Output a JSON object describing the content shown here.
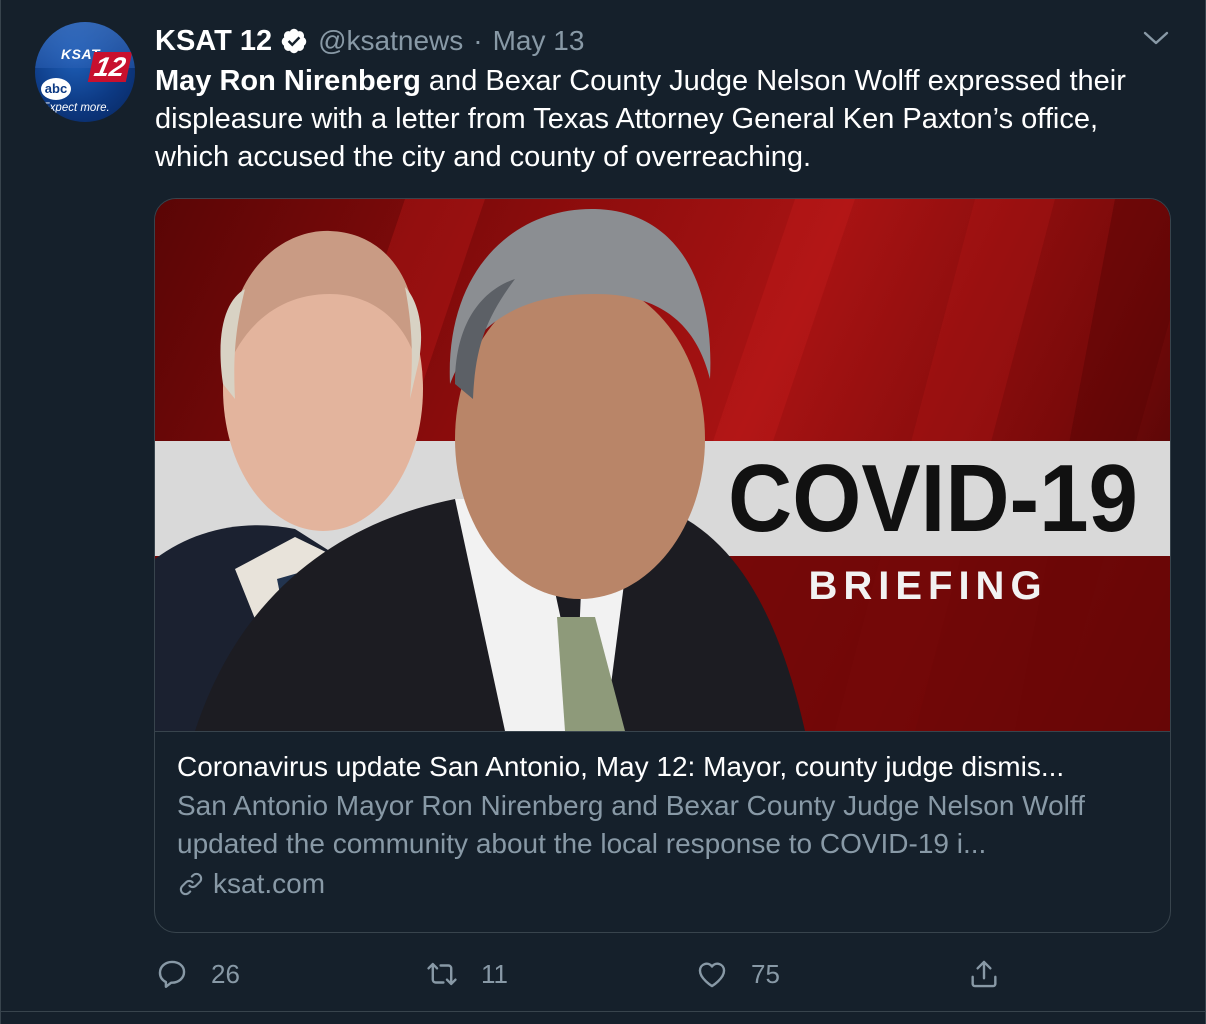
{
  "account": {
    "display_name": "KSAT 12",
    "handle": "@ksatnews",
    "separator": "·",
    "date": "May 13",
    "avatar": {
      "brand": "KSAT",
      "number": "12",
      "network": "abc",
      "tagline": "Expect more."
    }
  },
  "tweet": {
    "text_bold": "May Ron Nirenberg",
    "text_rest": " and Bexar County Judge Nelson Wolff expressed their displeasure with a letter from Texas Attorney General Ken Paxton’s office, which accused the city and county of overreaching."
  },
  "card": {
    "image": {
      "headline": "COVID-19",
      "subhead": "BRIEFING"
    },
    "title": "Coronavirus update San Antonio, May 12: Mayor, county judge dismis...",
    "description": "San Antonio Mayor Ron Nirenberg and Bexar County Judge Nelson Wolff updated the community about the local response to COVID-19 i...",
    "domain": "ksat.com"
  },
  "actions": {
    "reply_count": "26",
    "retweet_count": "11",
    "like_count": "75"
  },
  "icons": {
    "verified": "verified-badge-icon",
    "caret": "chevron-down-icon",
    "link": "link-icon",
    "reply": "reply-icon",
    "retweet": "retweet-icon",
    "like": "heart-icon",
    "share": "share-icon"
  },
  "colors": {
    "background": "#15202b",
    "border": "#38444d",
    "secondary_text": "#8899a6",
    "accent_red": "#c8102e"
  }
}
